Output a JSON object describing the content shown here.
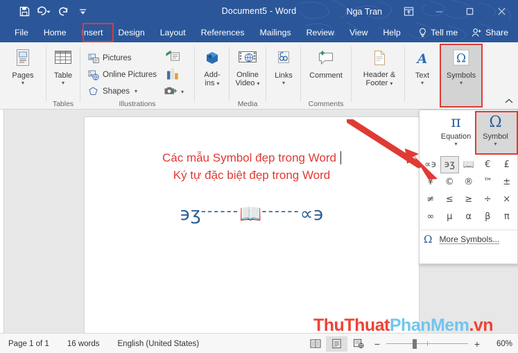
{
  "titlebar": {
    "quick_access": [
      {
        "name": "save-icon",
        "label": "Save"
      },
      {
        "name": "undo-icon",
        "label": "Undo"
      },
      {
        "name": "redo-icon",
        "label": "Redo"
      },
      {
        "name": "customize-qat-icon",
        "label": "Customize Quick Access Toolbar"
      }
    ],
    "document_title": "Document5  -  Word",
    "user_name": "Nga Tran",
    "window_controls": [
      {
        "name": "ribbon-display-options-icon",
        "label": "Ribbon Display Options"
      },
      {
        "name": "minimize-icon",
        "label": "Minimize"
      },
      {
        "name": "maximize-icon",
        "label": "Maximize"
      },
      {
        "name": "close-icon",
        "label": "Close"
      }
    ]
  },
  "tabs": {
    "items": [
      {
        "label": "File",
        "selected": false
      },
      {
        "label": "Home",
        "selected": false
      },
      {
        "label": "Insert",
        "selected": true
      },
      {
        "label": "Design",
        "selected": false
      },
      {
        "label": "Layout",
        "selected": false
      },
      {
        "label": "References",
        "selected": false
      },
      {
        "label": "Mailings",
        "selected": false
      },
      {
        "label": "Review",
        "selected": false
      },
      {
        "label": "View",
        "selected": false
      },
      {
        "label": "Help",
        "selected": false
      }
    ],
    "tell_me": "Tell me",
    "share": "Share"
  },
  "ribbon": {
    "groups": [
      {
        "name": "pages",
        "label": ""
      },
      {
        "name": "tables",
        "label": "Tables"
      },
      {
        "name": "illustrations",
        "label": "Illustrations"
      },
      {
        "name": "addins",
        "label": ""
      },
      {
        "name": "media",
        "label": "Media"
      },
      {
        "name": "links",
        "label": ""
      },
      {
        "name": "comments",
        "label": "Comments"
      },
      {
        "name": "headerfooter",
        "label": ""
      },
      {
        "name": "text",
        "label": ""
      },
      {
        "name": "symbols",
        "label": ""
      }
    ],
    "pages_label": "Pages",
    "table_label": "Table",
    "pictures_label": "Pictures",
    "online_pictures_label": "Online Pictures",
    "shapes_label": "Shapes",
    "addins_label": "Add-ins",
    "online_video_label": "Online Video",
    "links_label": "Links",
    "comment_label": "Comment",
    "header_footer_label": "Header & Footer",
    "text_label": "Text",
    "symbols_label": "Symbols",
    "collapse_label": "^"
  },
  "document": {
    "line1": "Các mẫu Symbol đẹp trong Word",
    "line2": "Ký tự đặc biệt đẹp trong Word",
    "decoration_left": "϶ʒ",
    "decoration_dash_left": "------",
    "decoration_center": "📖",
    "decoration_dash_right": "------",
    "decoration_right": "∝϶",
    "text_color": "#e03a34",
    "decoration_color": "#2e5f96"
  },
  "watermark": {
    "part1": "ThuThuat",
    "part2": "PhanMem",
    "part3": ".vn",
    "color1": "#ef4236",
    "color2": "#6fc6ef"
  },
  "symbol_panel": {
    "equation_label": "Equation",
    "equation_icon": "π",
    "symbol_label": "Symbol",
    "symbol_icon": "Ω",
    "grid": [
      [
        {
          "glyph": "∝϶",
          "name": "symbol-so-ligature",
          "selected": false
        },
        {
          "glyph": "϶ʒ",
          "name": "symbol-cs-ligature",
          "selected": true
        },
        {
          "glyph": "📖",
          "name": "symbol-open-book",
          "selected": false
        },
        {
          "glyph": "€",
          "name": "symbol-euro",
          "selected": false
        },
        {
          "glyph": "£",
          "name": "symbol-pound",
          "selected": false
        }
      ],
      [
        {
          "glyph": "¥",
          "name": "symbol-yen",
          "selected": false
        },
        {
          "glyph": "©",
          "name": "symbol-copyright",
          "selected": false
        },
        {
          "glyph": "®",
          "name": "symbol-registered",
          "selected": false
        },
        {
          "glyph": "™",
          "name": "symbol-trademark",
          "selected": false
        },
        {
          "glyph": "±",
          "name": "symbol-plus-minus",
          "selected": false
        }
      ],
      [
        {
          "glyph": "≠",
          "name": "symbol-not-equal",
          "selected": false
        },
        {
          "glyph": "≤",
          "name": "symbol-less-equal",
          "selected": false
        },
        {
          "glyph": "≥",
          "name": "symbol-greater-equal",
          "selected": false
        },
        {
          "glyph": "÷",
          "name": "symbol-division",
          "selected": false
        },
        {
          "glyph": "×",
          "name": "symbol-multiplication",
          "selected": false
        }
      ],
      [
        {
          "glyph": "∞",
          "name": "symbol-infinity",
          "selected": false
        },
        {
          "glyph": "μ",
          "name": "symbol-mu",
          "selected": false
        },
        {
          "glyph": "α",
          "name": "symbol-alpha",
          "selected": false
        },
        {
          "glyph": "β",
          "name": "symbol-beta",
          "selected": false
        },
        {
          "glyph": "π",
          "name": "symbol-pi",
          "selected": false
        }
      ]
    ],
    "more_symbols_label": "More Symbols...",
    "more_symbols_icon": "Ω"
  },
  "statusbar": {
    "page_info": "Page 1 of 1",
    "word_count": "16 words",
    "language": "English (United States)",
    "views": [
      {
        "name": "read-mode-icon",
        "label": "Read Mode",
        "active": false
      },
      {
        "name": "print-layout-icon",
        "label": "Print Layout",
        "active": true
      },
      {
        "name": "web-layout-icon",
        "label": "Web Layout",
        "active": false
      }
    ],
    "zoom_out": "−",
    "zoom_in": "+",
    "zoom_level": "60%"
  },
  "annotations": {
    "highlight_color": "#e03a34",
    "arrow_color": "#e03a34"
  }
}
